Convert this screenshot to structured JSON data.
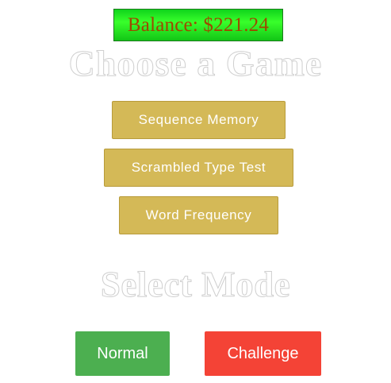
{
  "balance": {
    "text": "Balance: $221.24"
  },
  "games": {
    "heading": "Choose a Game",
    "items": [
      {
        "label": "Sequence Memory"
      },
      {
        "label": "Scrambled Type Test"
      },
      {
        "label": "Word Frequency"
      }
    ]
  },
  "mode": {
    "heading": "Select Mode",
    "normal_label": "Normal",
    "challenge_label": "Challenge"
  },
  "colors": {
    "balance_bg": "#2ee62a",
    "balance_text": "#9c4a00",
    "game_button": "#d4b957",
    "normal_button": "#4caf50",
    "challenge_button": "#f44336"
  }
}
